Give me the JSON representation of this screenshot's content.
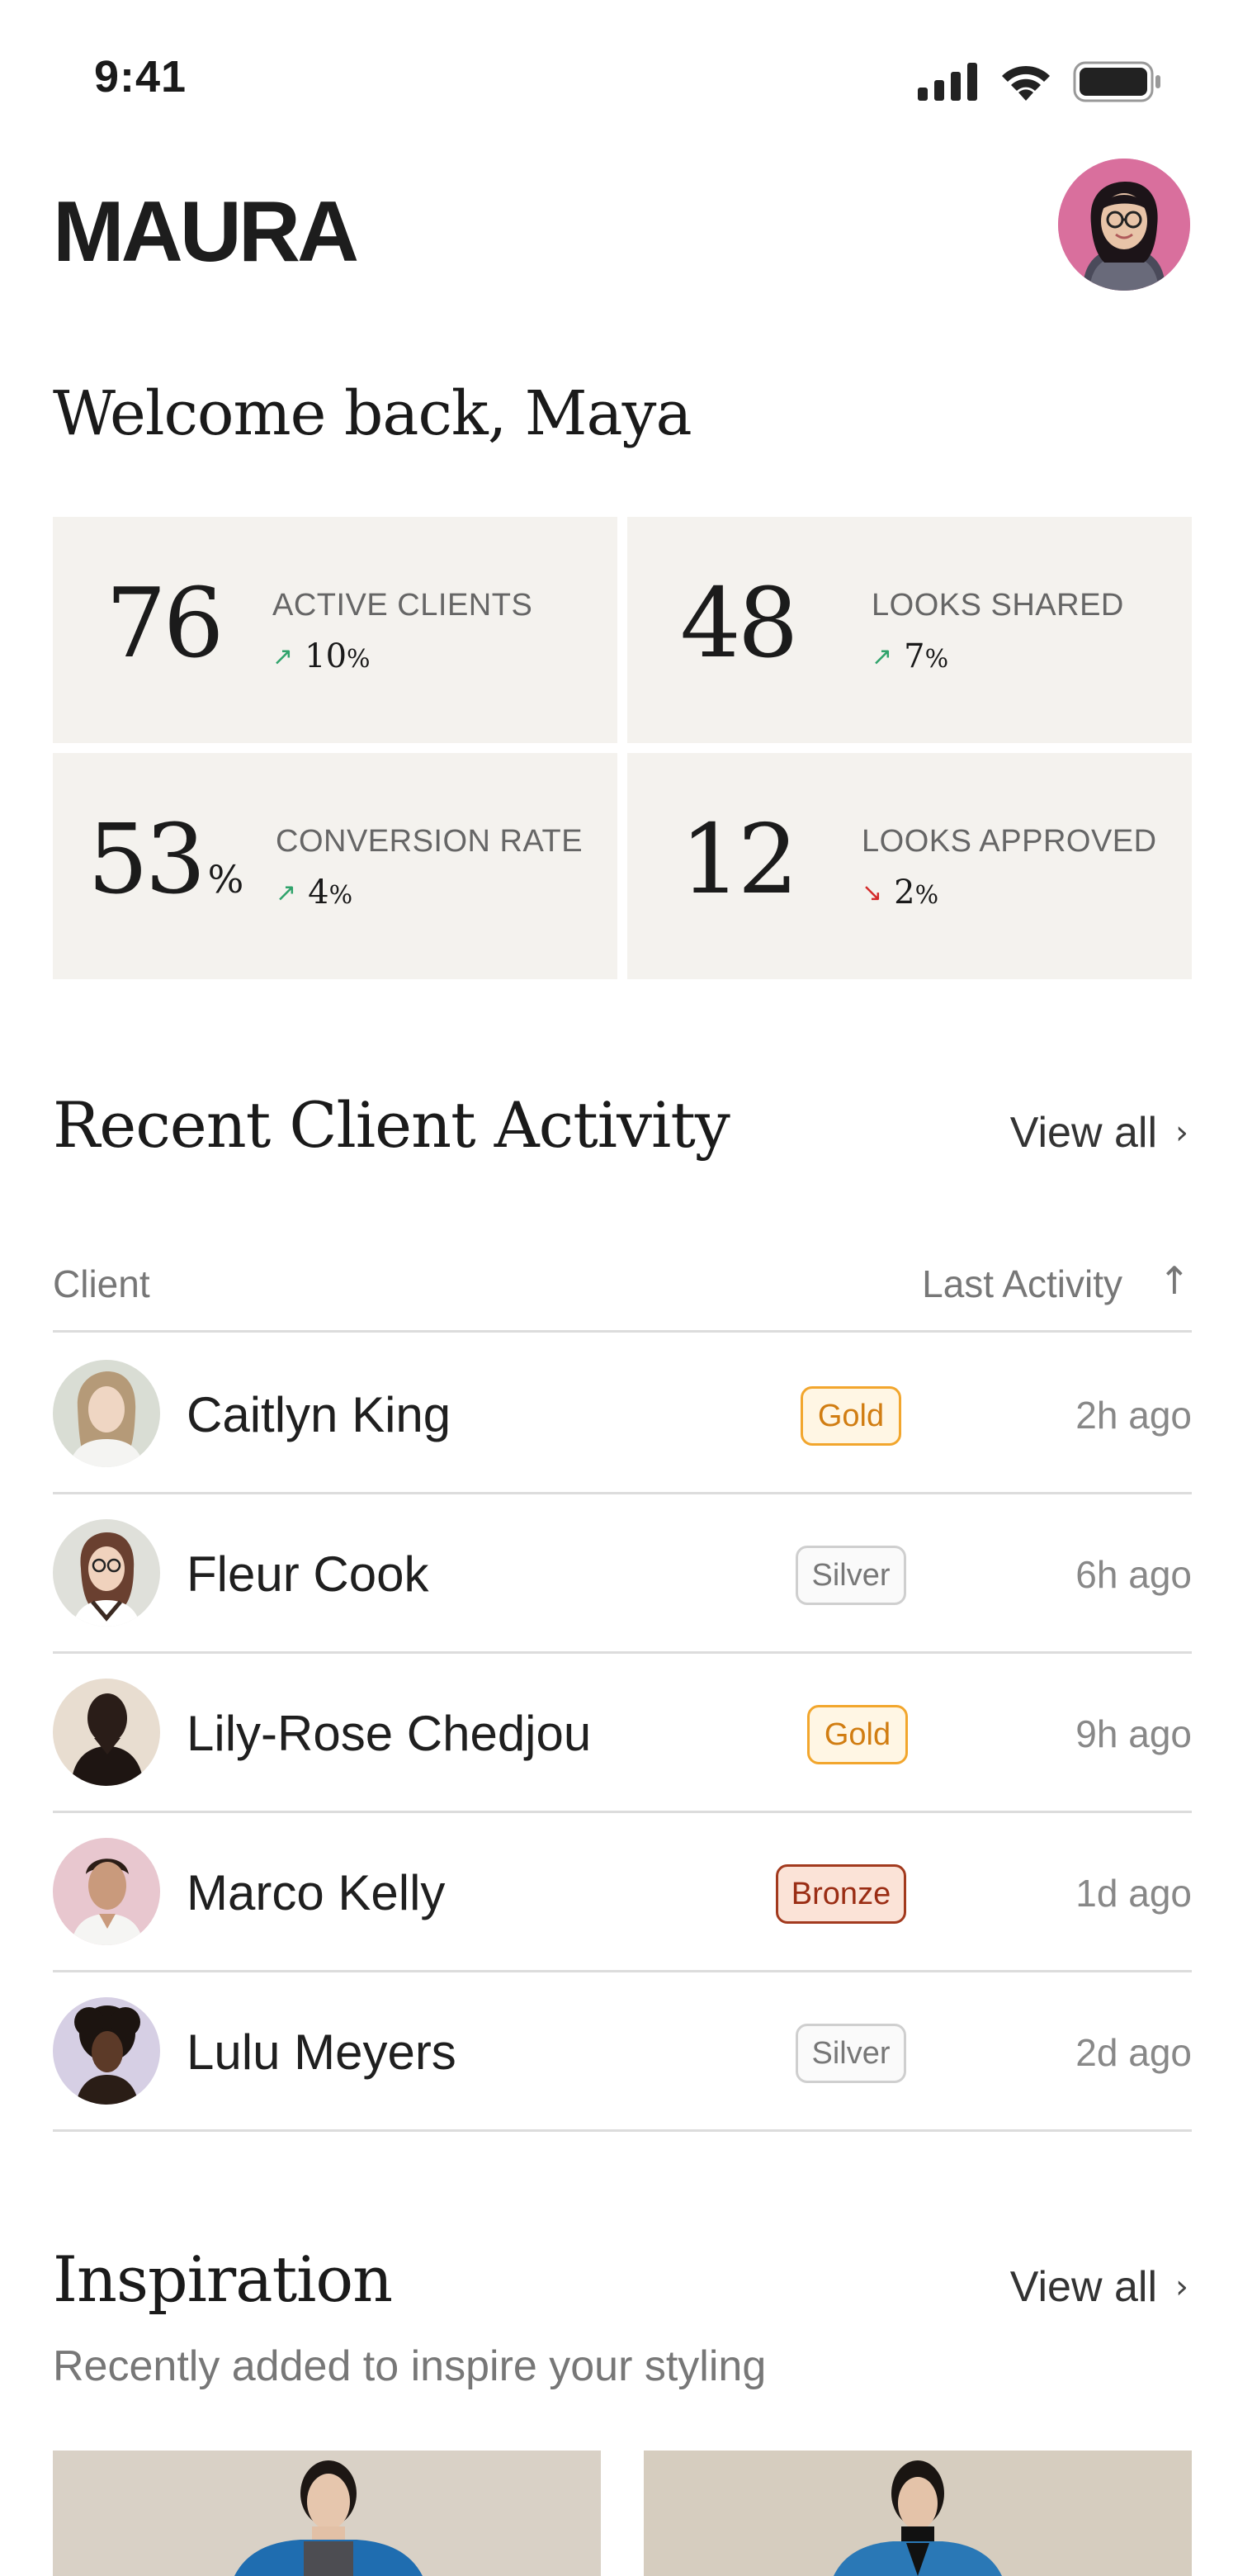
{
  "status_bar": {
    "time": "9:41"
  },
  "header": {
    "brand": "MAURA"
  },
  "welcome": "Welcome back, Maya",
  "stats": [
    {
      "value": "76",
      "suffix": "",
      "label": "ACTIVE CLIENTS",
      "change": "10",
      "unit": "%",
      "direction": "up"
    },
    {
      "value": "48",
      "suffix": "",
      "label": "LOOKS SHARED",
      "change": "7",
      "unit": "%",
      "direction": "up"
    },
    {
      "value": "53",
      "suffix": "%",
      "label": "CONVERSION RATE",
      "change": "4",
      "unit": "%",
      "direction": "up"
    },
    {
      "value": "12",
      "suffix": "",
      "label": "LOOKS APPROVED",
      "change": "2",
      "unit": "%",
      "direction": "down"
    }
  ],
  "activity": {
    "title": "Recent Client Activity",
    "view_all": "View all",
    "columns": {
      "client": "Client",
      "last_activity": "Last Activity"
    },
    "rows": [
      {
        "name": "Caitlyn King",
        "tier": "Gold",
        "time": "2h ago"
      },
      {
        "name": "Fleur Cook",
        "tier": "Silver",
        "time": "6h ago"
      },
      {
        "name": "Lily-Rose Chedjou",
        "tier": "Gold",
        "time": "9h ago"
      },
      {
        "name": "Marco Kelly",
        "tier": "Bronze",
        "time": "1d ago"
      },
      {
        "name": "Lulu Meyers",
        "tier": "Silver",
        "time": "2d ago"
      }
    ]
  },
  "inspiration": {
    "title": "Inspiration",
    "view_all": "View all",
    "subtitle": "Recently added to inspire your styling"
  },
  "colors": {
    "accent_up": "#2fa36b",
    "accent_down": "#d42a2a",
    "stat_bg": "#f4f2ee",
    "gold": "#f2a62d",
    "silver": "#cfcfcf",
    "bronze": "#a23a1e"
  }
}
